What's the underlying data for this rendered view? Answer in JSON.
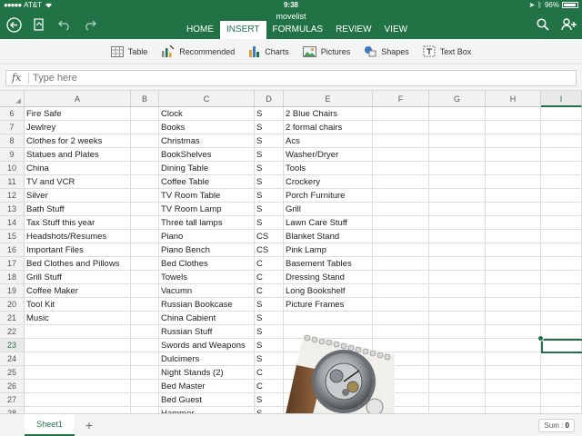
{
  "status": {
    "carrier": "AT&T",
    "time": "9:38",
    "battery": "96%"
  },
  "doc_title": "movelist",
  "tabs": [
    "HOME",
    "INSERT",
    "FORMULAS",
    "REVIEW",
    "VIEW"
  ],
  "active_tab": "INSERT",
  "toolbar": [
    {
      "label": "Table",
      "icon": "table-icon"
    },
    {
      "label": "Recommended",
      "icon": "recommended-chart-icon"
    },
    {
      "label": "Charts",
      "icon": "bar-chart-icon"
    },
    {
      "label": "Pictures",
      "icon": "picture-icon"
    },
    {
      "label": "Shapes",
      "icon": "shapes-icon"
    },
    {
      "label": "Text Box",
      "icon": "text-box-icon"
    }
  ],
  "formula": {
    "fx": "fx",
    "placeholder": "Type here"
  },
  "columns": [
    "A",
    "B",
    "C",
    "D",
    "E",
    "F",
    "G",
    "H",
    "I"
  ],
  "selected_column": "I",
  "selected_row": "23",
  "rows": [
    {
      "num": "6",
      "A": "Fire Safe",
      "C": "Clock",
      "D": "S",
      "E": "2 Blue Chairs"
    },
    {
      "num": "7",
      "A": "Jewlrey",
      "C": "Books",
      "D": "S",
      "E": "2 formal chairs"
    },
    {
      "num": "8",
      "A": "Clothes for 2 weeks",
      "C": "Christmas",
      "D": "S",
      "E": "Acs"
    },
    {
      "num": "9",
      "A": "Statues and Plates",
      "C": "BookShelves",
      "D": "S",
      "E": "Washer/Dryer"
    },
    {
      "num": "10",
      "A": "China",
      "C": "Dining Table",
      "D": "S",
      "E": "Tools"
    },
    {
      "num": "11",
      "A": "TV and VCR",
      "C": "Coffee Table",
      "D": "S",
      "E": "Crockery"
    },
    {
      "num": "12",
      "A": "Silver",
      "C": "TV Room Table",
      "D": "S",
      "E": "Porch Furniture"
    },
    {
      "num": "13",
      "A": "Bath Stuff",
      "C": "TV Room Lamp",
      "D": "S",
      "E": "Grill"
    },
    {
      "num": "14",
      "A": "Tax Stuff this year",
      "C": "Three tall lamps",
      "D": "S",
      "E": "Lawn Care Stuff"
    },
    {
      "num": "15",
      "A": "Headshots/Resumes",
      "C": "Piano",
      "D": "CS",
      "E": "Blanket Stand"
    },
    {
      "num": "16",
      "A": "Important Files",
      "C": "Piano Bench",
      "D": "CS",
      "E": "Pink Lamp"
    },
    {
      "num": "17",
      "A": "Bed Clothes and Pillows",
      "C": "Bed Clothes",
      "D": "C",
      "E": "Basement Tables"
    },
    {
      "num": "18",
      "A": "Grill Stuff",
      "C": "Towels",
      "D": "C",
      "E": "Dressing Stand"
    },
    {
      "num": "19",
      "A": "Coffee Maker",
      "C": "Vacumn",
      "D": "C",
      "E": "Long Bookshelf"
    },
    {
      "num": "20",
      "A": "Tool Kit",
      "C": "Russian Bookcase",
      "D": "S",
      "E": "Picture Frames"
    },
    {
      "num": "21",
      "A": "Music",
      "C": "China Cabient",
      "D": "S",
      "E": ""
    },
    {
      "num": "22",
      "A": "",
      "C": "Russian Stuff",
      "D": "S",
      "E": ""
    },
    {
      "num": "23",
      "A": "",
      "C": "Swords and Weapons",
      "D": "S",
      "E": ""
    },
    {
      "num": "24",
      "A": "",
      "C": "Dulcimers",
      "D": "S",
      "E": ""
    },
    {
      "num": "25",
      "A": "",
      "C": "Night Stands (2)",
      "D": "C",
      "E": ""
    },
    {
      "num": "26",
      "A": "",
      "C": "Bed Master",
      "D": "C",
      "E": ""
    },
    {
      "num": "27",
      "A": "",
      "C": "Bed Guest",
      "D": "S",
      "E": ""
    },
    {
      "num": "28",
      "A": "",
      "C": "Hammer",
      "D": "S",
      "E": ""
    }
  ],
  "sheet": {
    "name": "Sheet1",
    "add": "+"
  },
  "sum": {
    "label": "Sum :",
    "value": "0"
  },
  "colors": {
    "accent": "#217346"
  }
}
